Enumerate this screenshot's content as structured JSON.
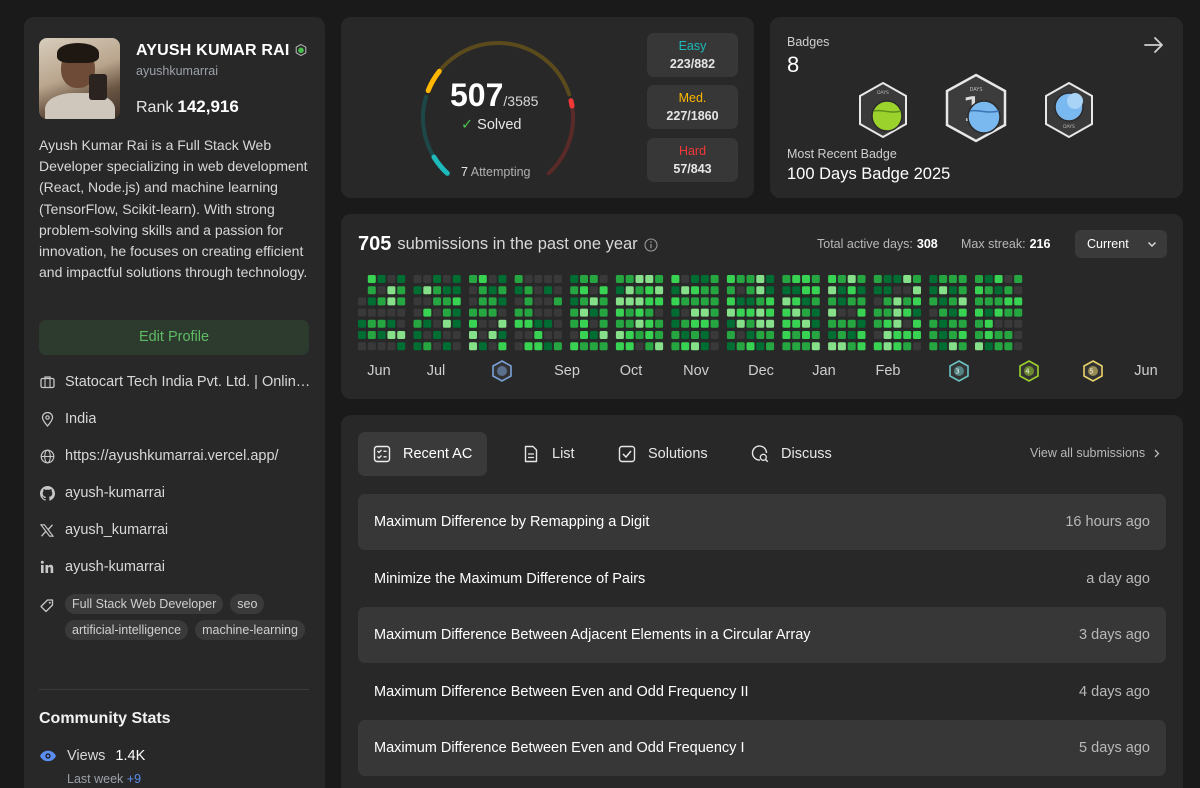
{
  "profile": {
    "name": "AYUSH KUMAR RAI",
    "username": "ayushkumarrai",
    "rank_label": "Rank",
    "rank_value": "142,916",
    "bio": "Ayush Kumar Rai is a Full Stack Web Developer specializing in web development (React, Node.js) and machine learning (TensorFlow, Scikit-learn). With strong problem-solving skills and a passion for innovation, he focuses on creating efficient and impactful solutions through technology.",
    "edit_label": "Edit Profile",
    "company": "Statocart Tech India Pvt. Ltd. | Online Marketing Services",
    "location": "India",
    "website": "https://ayushkumarrai.vercel.app/",
    "github": "ayush-kumarrai",
    "twitter": "ayush_kumarrai",
    "linkedin": "ayush-kumarrai",
    "tags": [
      "Full Stack Web Developer",
      "seo",
      "artificial-intelligence",
      "machine-learning"
    ]
  },
  "community": {
    "title": "Community Stats",
    "views_label": "Views",
    "views_value": "1.4K",
    "last_week_label": "Last week",
    "last_week_value": "+9"
  },
  "progress": {
    "solved": "507",
    "total": "/3585",
    "solved_label": "Solved",
    "attempting_count": "7",
    "attempting_label": "Attempting",
    "easy_label": "Easy",
    "easy_value": "223/882",
    "med_label": "Med.",
    "med_value": "227/1860",
    "hard_label": "Hard",
    "hard_value": "57/843",
    "easy_solved": 223,
    "easy_total": 882,
    "med_solved": 227,
    "med_total": 1860,
    "hard_solved": 57,
    "hard_total": 843
  },
  "badges": {
    "title": "Badges",
    "count": "8",
    "recent_label": "Most Recent Badge",
    "recent_name": "100 Days Badge 2025",
    "days_text": "DAYS",
    "hundred_digits": "1"
  },
  "calendar": {
    "count": "705",
    "title_text": "submissions in the past one year",
    "active_label": "Total active days:",
    "active_value": "308",
    "streak_label": "Max streak:",
    "streak_value": "216",
    "select_label": "Current",
    "months": [
      "Jun",
      "Jul",
      "Sep",
      "Oct",
      "Nov",
      "Dec",
      "Jan",
      "Feb",
      "Jun"
    ],
    "month_badge_digits": [
      "3",
      "4",
      "5"
    ],
    "colors": [
      "#393939",
      "#0e4429",
      "#006d32",
      "#26a641",
      "#39d353",
      "#86e08a"
    ]
  },
  "recent": {
    "tabs": [
      "Recent AC",
      "List",
      "Solutions",
      "Discuss"
    ],
    "view_all": "View all submissions",
    "rows": [
      {
        "title": "Maximum Difference by Remapping a Digit",
        "time": "16 hours ago"
      },
      {
        "title": "Minimize the Maximum Difference of Pairs",
        "time": "a day ago"
      },
      {
        "title": "Maximum Difference Between Adjacent Elements in a Circular Array",
        "time": "3 days ago"
      },
      {
        "title": "Maximum Difference Between Even and Odd Frequency II",
        "time": "4 days ago"
      },
      {
        "title": "Maximum Difference Between Even and Odd Frequency I",
        "time": "5 days ago"
      }
    ]
  }
}
